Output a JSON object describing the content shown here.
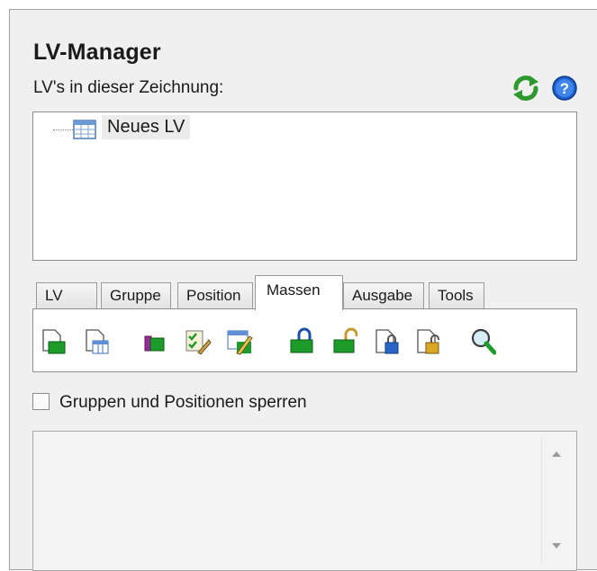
{
  "panel": {
    "title": "LV-Manager",
    "subtitle": "LV's in dieser Zeichnung:"
  },
  "header_icons": [
    "refresh-icon",
    "help-icon"
  ],
  "tree": {
    "items": [
      {
        "label": "Neues LV",
        "icon": "table-icon"
      }
    ]
  },
  "tabs": [
    {
      "label": "LV",
      "active": false
    },
    {
      "label": "Gruppe",
      "active": false
    },
    {
      "label": "Position",
      "active": false
    },
    {
      "label": "Massen",
      "active": true
    },
    {
      "label": "Ausgabe",
      "active": false
    },
    {
      "label": "Tools",
      "active": false
    }
  ],
  "toolbar_icons": [
    "new-document-green-icon",
    "table-document-icon",
    "purple-document-icon",
    "checklist-edit-icon",
    "table-edit-icon",
    "lock-closed-icon",
    "lock-open-icon",
    "document-lock-blue-icon",
    "document-lock-gold-icon",
    "magnifier-icon"
  ],
  "lock_option": {
    "label": "Gruppen und Positionen sperren",
    "checked": false
  },
  "colors": {
    "panel_bg": "#f0f0f0",
    "border": "#8e8f8f",
    "refresh_green": "#2e9a2e",
    "help_blue": "#1f5fcf"
  }
}
